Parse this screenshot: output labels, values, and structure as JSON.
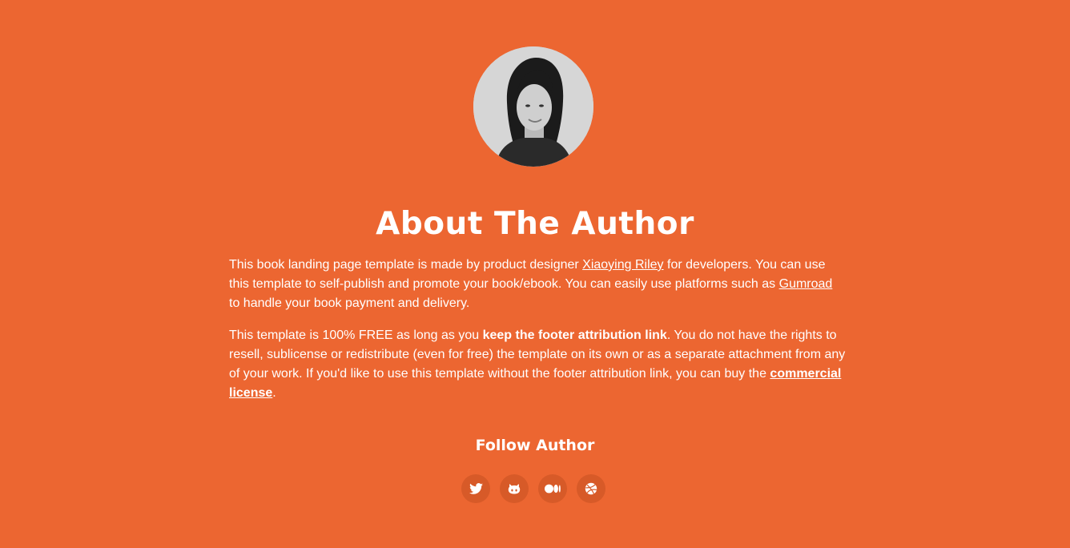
{
  "author": {
    "photo_icon": "author-portrait",
    "heading": "About The Author"
  },
  "bio": {
    "p1_before": "This book landing page template is made by product designer ",
    "p1_link1": "Xiaoying Riley",
    "p1_middle": " for developers. You can use this template to self-publish and promote your book/ebook. You can easily use platforms such as ",
    "p1_link2": "Gumroad",
    "p1_after": " to handle your book payment and delivery.",
    "p2_before": "This template is 100% FREE as long as you ",
    "p2_bold": "keep the footer attribution link",
    "p2_middle": ". You do not have the rights to resell, sublicense or redistribute (even for free) the template on its own or as a separate attachment from any of your work. If you'd like to use this template without the footer attribution link, you can buy the ",
    "p2_link": "commercial license",
    "p2_after": "."
  },
  "follow": {
    "title": "Follow Author",
    "icons": [
      "twitter-icon",
      "github-icon",
      "medium-icon",
      "dribbble-icon"
    ]
  },
  "colors": {
    "background": "#ec6631",
    "social_button": "#d75a28",
    "text": "#ffffff"
  }
}
